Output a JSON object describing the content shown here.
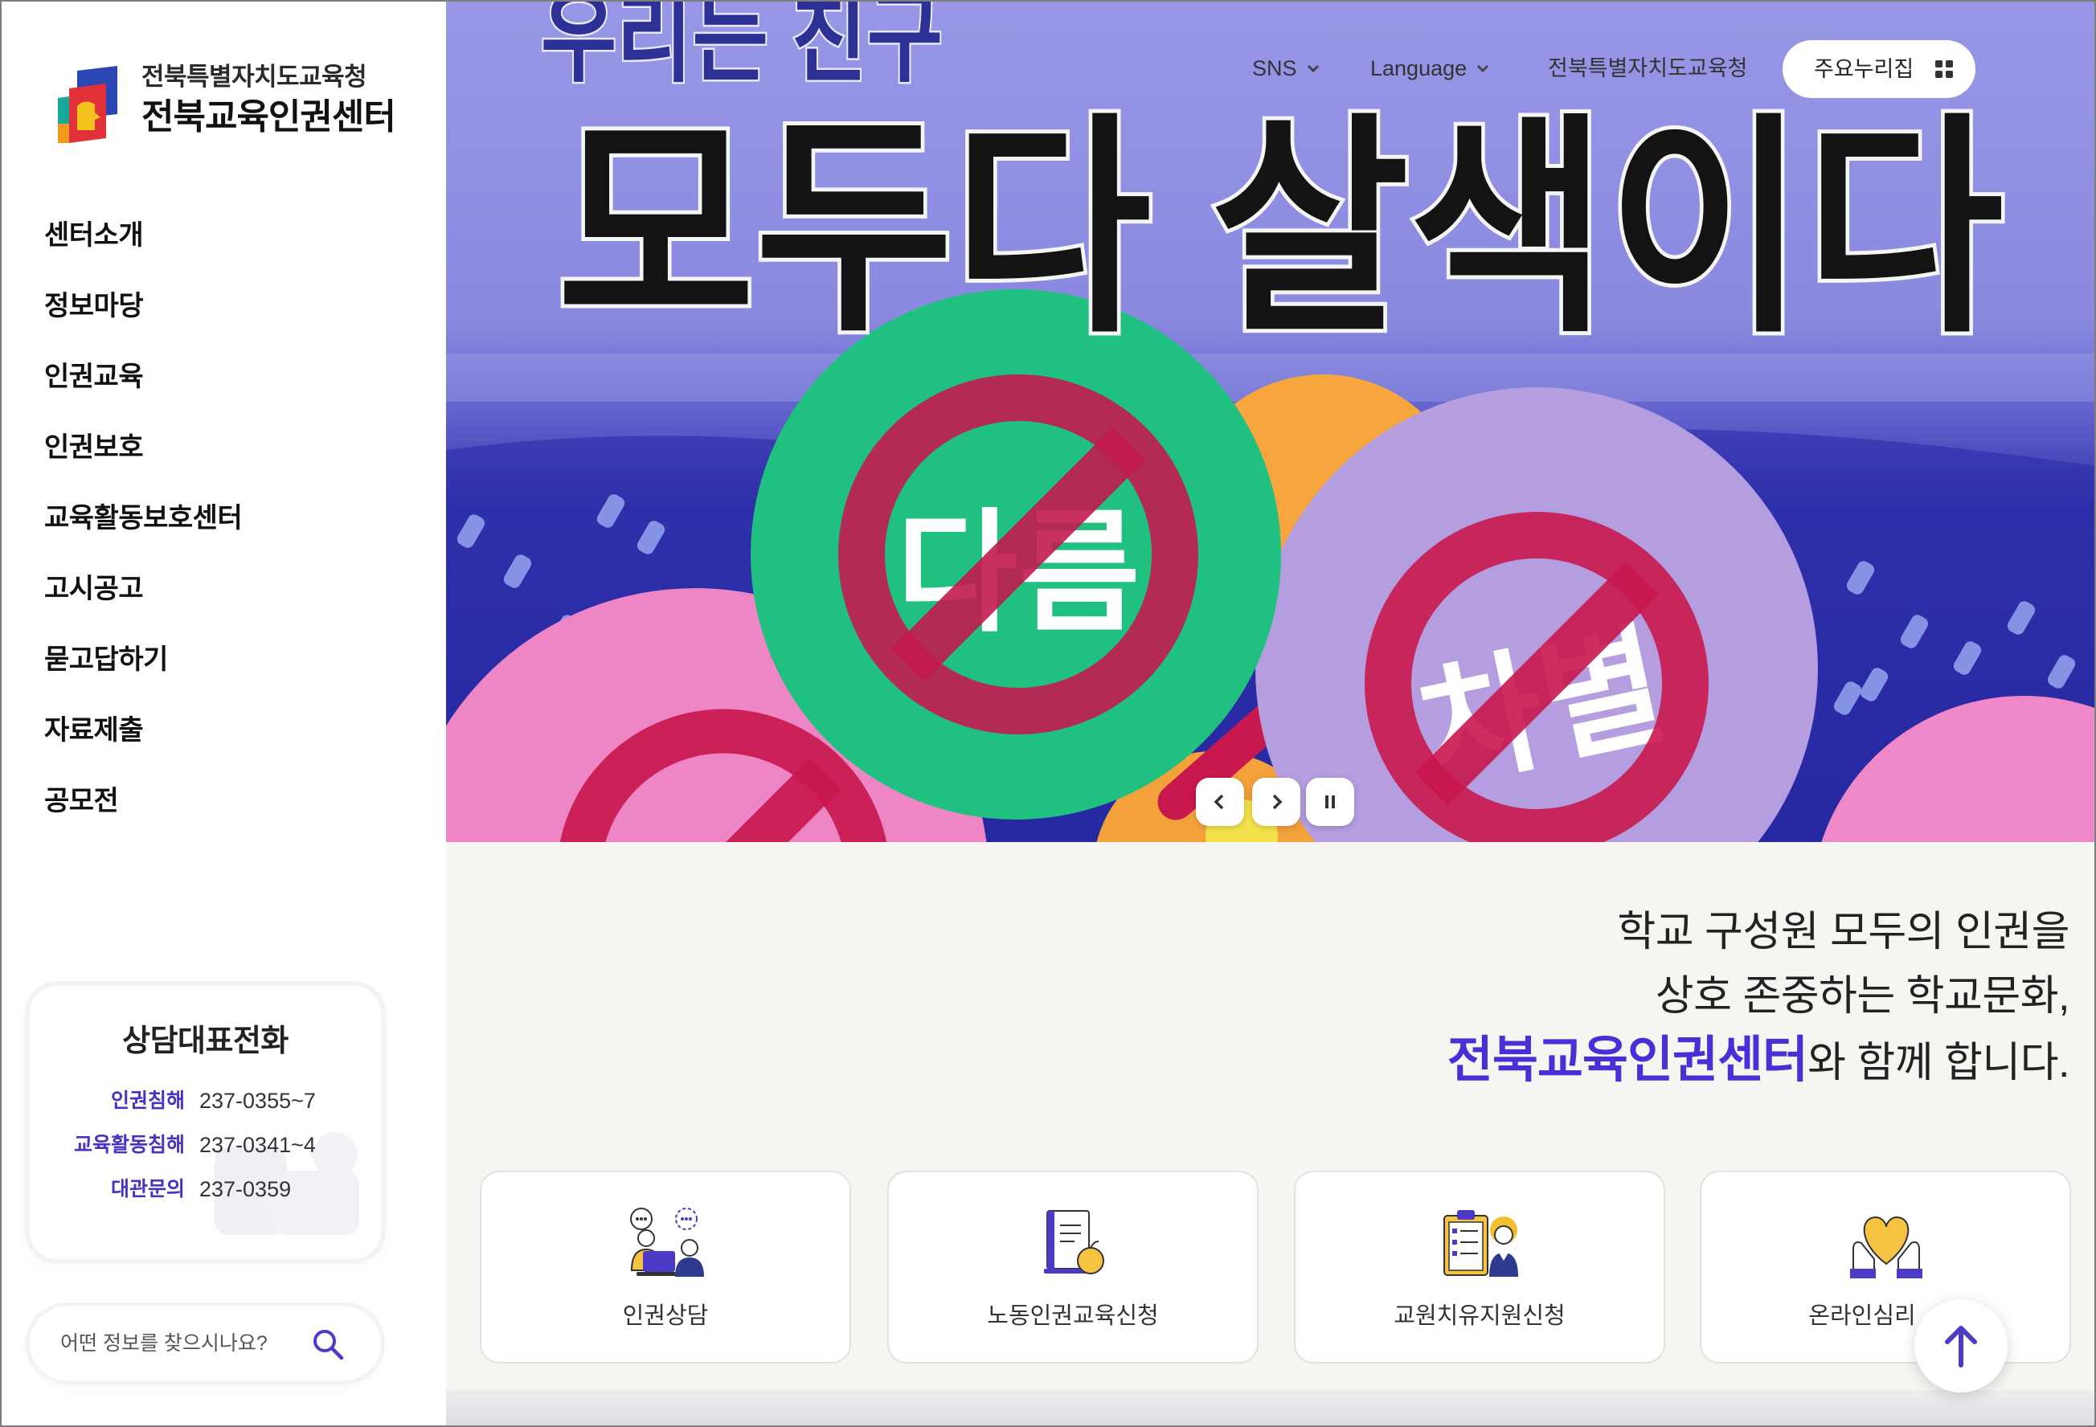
{
  "logo": {
    "org": "전북특별자치도교육청",
    "name": "전북교육인권센터",
    "icon": "center-logo-icon"
  },
  "nav": {
    "items": [
      "센터소개",
      "정보마당",
      "인권교육",
      "인권보호",
      "교육활동보호센터",
      "고시공고",
      "묻고답하기",
      "자료제출",
      "공모전"
    ]
  },
  "consult": {
    "title": "상담대표전화",
    "rows": [
      {
        "label": "인권침해",
        "value": "237-0355~7"
      },
      {
        "label": "교육활동침해",
        "value": "237-0341~4"
      },
      {
        "label": "대관문의",
        "value": "237-0359"
      }
    ]
  },
  "search": {
    "placeholder": "어떤 정보를 찾으시나요?",
    "icon": "search-icon"
  },
  "topbar": {
    "sns": "SNS",
    "language": "Language",
    "office_link": "전북특별자치도교육청",
    "sites_button": "주요누리집",
    "sites_icon": "grid-icon",
    "dropdown_icon": "chevron-down-icon"
  },
  "hero": {
    "subheadline": "우리는 친구",
    "headline": "모두다 살색이다",
    "sign_text_1": "다름",
    "sign_text_2": "차별",
    "controls": [
      "chevron-left-icon",
      "chevron-right-icon",
      "pause-icon"
    ]
  },
  "tagline": {
    "line1": "학교 구성원 모두의 인권을",
    "line2": "상호 존중하는 학교문화,",
    "highlight": "전북교육인권센터",
    "line3_rest": "와 함께 합니다."
  },
  "quick_links": [
    {
      "label": "인권상담",
      "icon": "counseling-icon"
    },
    {
      "label": "노동인권교육신청",
      "icon": "document-apple-icon"
    },
    {
      "label": "교원치유지원신청",
      "icon": "clipboard-teacher-icon"
    },
    {
      "label": "온라인심리",
      "icon": "heart-in-hands-icon"
    }
  ],
  "scroll_top": {
    "icon": "arrow-up-icon"
  },
  "colors": {
    "accent": "#4b2fd6",
    "label_purple": "#4533c4",
    "icon_yellow": "#f5c242",
    "hero_sky": "#9897e6",
    "hero_deep": "#1f2294",
    "balloon_green": "#1fc080",
    "balloon_purple": "#b59edf",
    "balloon_pink": "#ee86c6",
    "balloon_orange": "#f6a63c",
    "prohibition_red": "#c8184e"
  }
}
